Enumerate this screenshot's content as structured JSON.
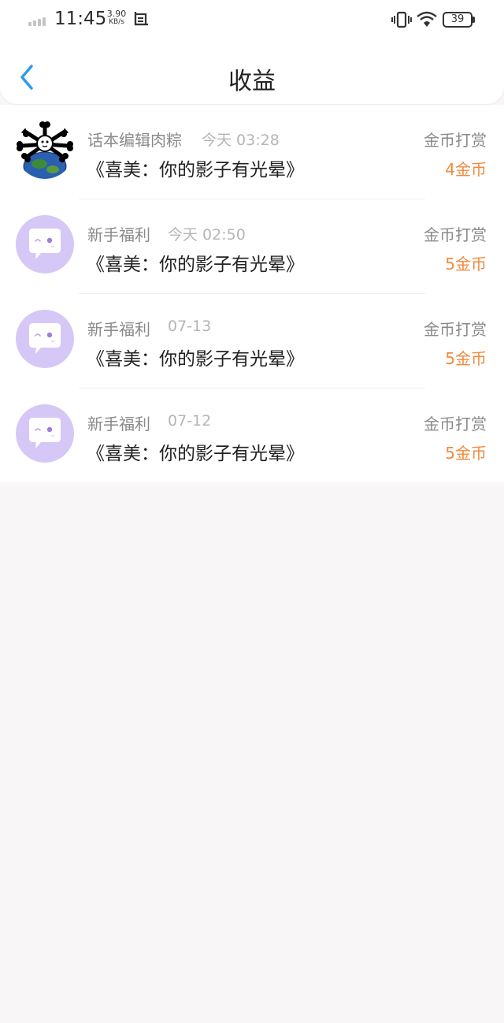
{
  "status_bar": {
    "time": "11:45",
    "net_speed_value": "3.90",
    "net_speed_unit": "KB/s",
    "battery_level": "39"
  },
  "nav": {
    "title": "收益"
  },
  "colors": {
    "accent_blue": "#2f9bea",
    "amount_orange": "#f08a3e",
    "avatar_purple": "#d6c8f6"
  },
  "records": [
    {
      "source": "话本编辑肉粽",
      "time": "今天 03:28",
      "book": "《喜美：你的影子有光晕》",
      "type": "金币打赏",
      "amount": "4金币",
      "avatar": "bone-earth-avatar"
    },
    {
      "source": "新手福利",
      "time": "今天 02:50",
      "book": "《喜美：你的影子有光晕》",
      "type": "金币打赏",
      "amount": "5金币",
      "avatar": "chat-bubble-avatar"
    },
    {
      "source": "新手福利",
      "time": "07-13",
      "book": "《喜美：你的影子有光晕》",
      "type": "金币打赏",
      "amount": "5金币",
      "avatar": "chat-bubble-avatar"
    },
    {
      "source": "新手福利",
      "time": "07-12",
      "book": "《喜美：你的影子有光晕》",
      "type": "金币打赏",
      "amount": "5金币",
      "avatar": "chat-bubble-avatar"
    }
  ]
}
